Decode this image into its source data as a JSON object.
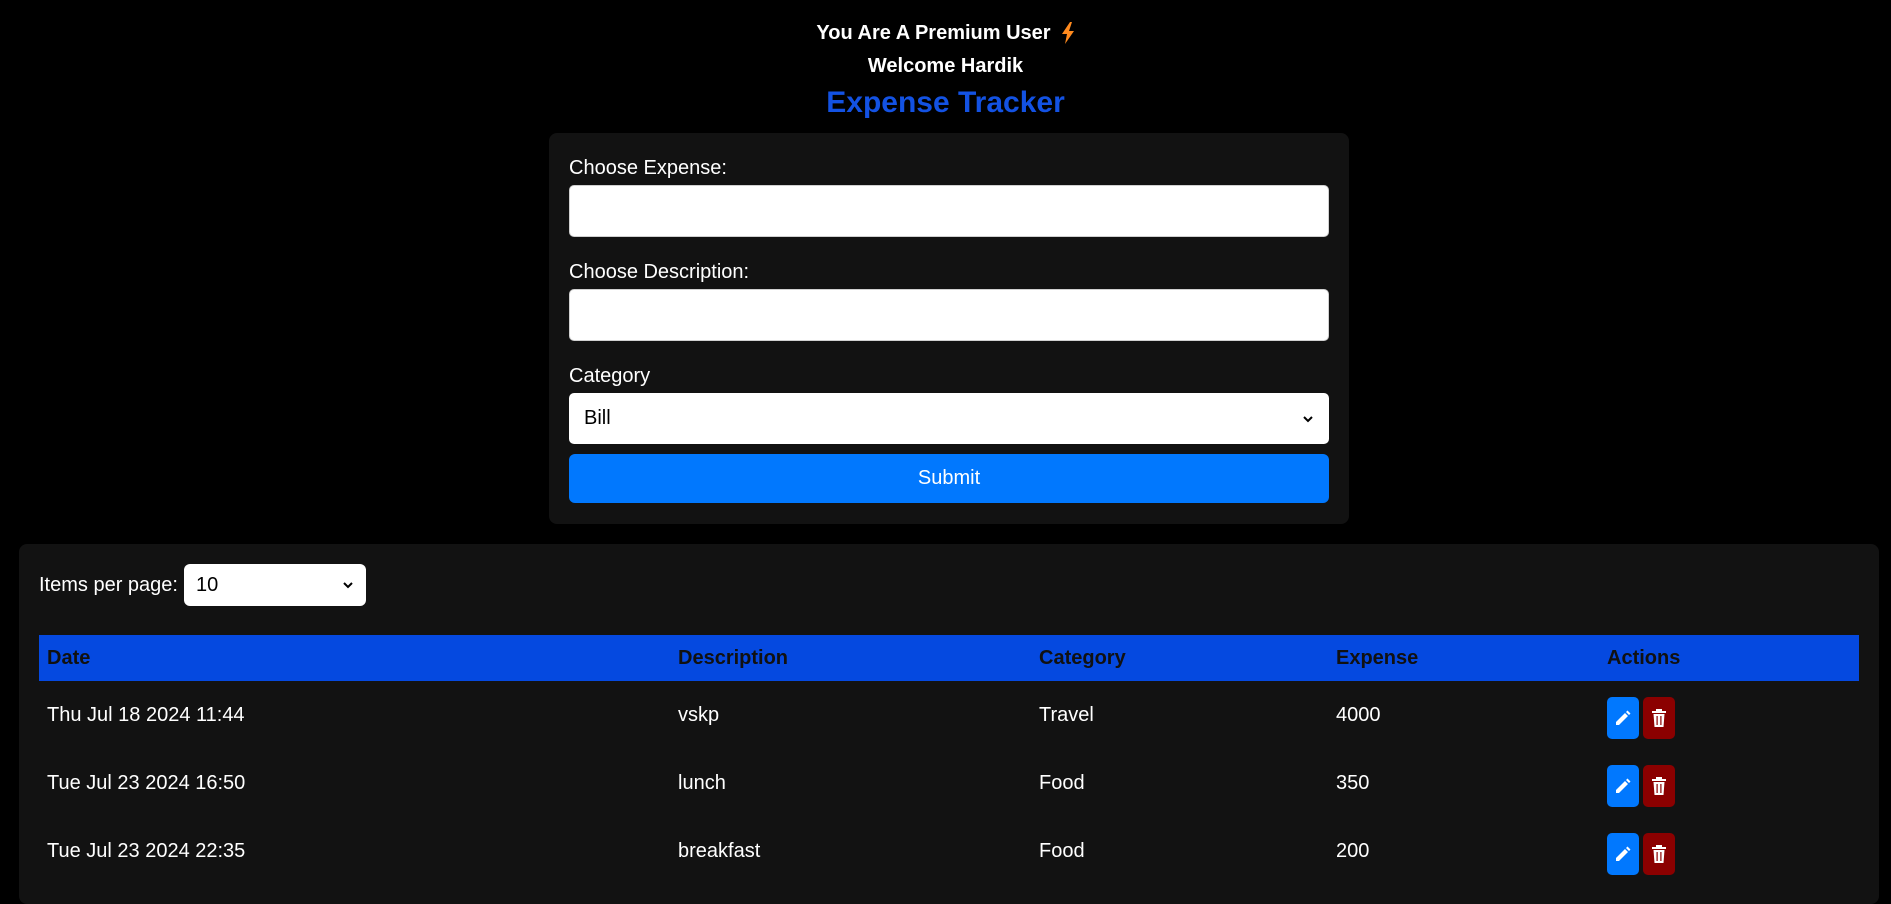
{
  "header": {
    "premium_text": "You Are A Premium User",
    "premium_icon": "lightning-bolt-icon",
    "welcome_text": "Welcome Hardik",
    "title": "Expense Tracker",
    "title_color": "#1352e3"
  },
  "form": {
    "expense_label": "Choose Expense:",
    "expense_value": "",
    "description_label": "Choose Description:",
    "description_value": "",
    "category_label": "Category",
    "category_selected": "Bill",
    "submit_label": "Submit",
    "submit_color": "#0178fe"
  },
  "table": {
    "items_per_page_label": "Items per page:",
    "items_per_page_value": "10",
    "columns": [
      "Date",
      "Description",
      "Category",
      "Expense",
      "Actions"
    ],
    "header_color": "#0549e0",
    "rows": [
      {
        "date": "Thu Jul 18 2024 11:44",
        "description": "vskp",
        "category": "Travel",
        "expense": "4000"
      },
      {
        "date": "Tue Jul 23 2024 16:50",
        "description": "lunch",
        "category": "Food",
        "expense": "350"
      },
      {
        "date": "Tue Jul 23 2024 22:35",
        "description": "breakfast",
        "category": "Food",
        "expense": "200"
      }
    ],
    "edit_icon": "pencil-icon",
    "delete_icon": "trash-icon",
    "edit_color": "#0178fe",
    "delete_color": "#8b0000"
  }
}
